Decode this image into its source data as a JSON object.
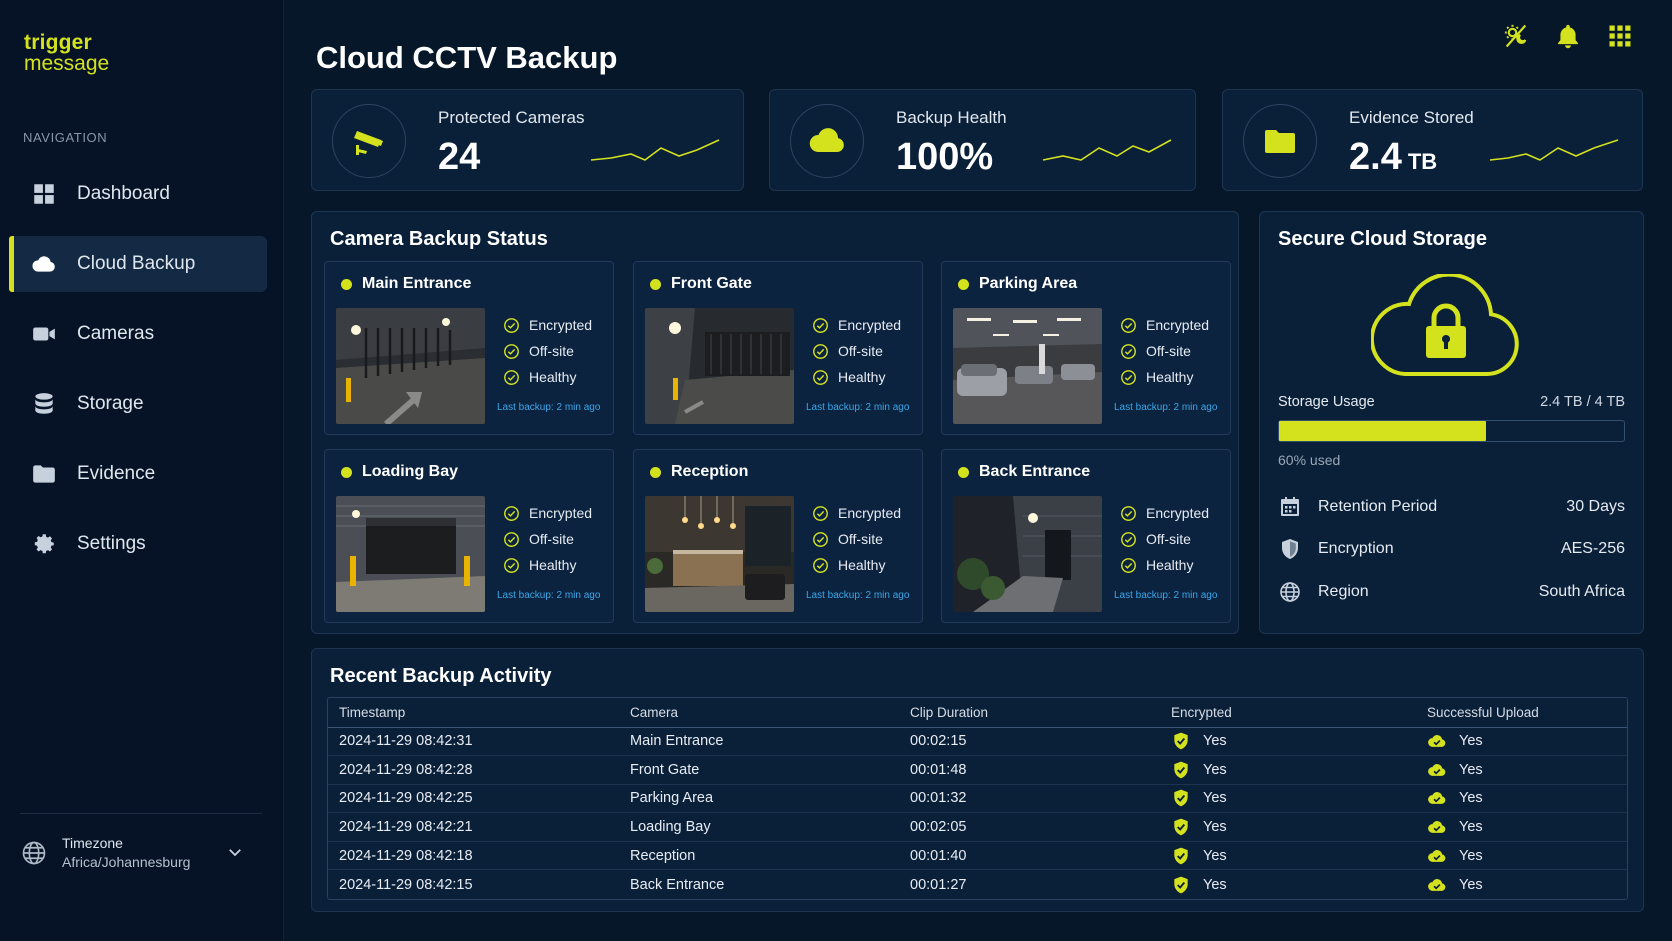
{
  "app": {
    "logo_line1": "trigger",
    "logo_line2": "message",
    "page_title": "Cloud CCTV Backup",
    "accent_color": "#d4e21e"
  },
  "sidebar": {
    "heading": "NAVIGATION",
    "items": [
      {
        "label": "Dashboard",
        "icon": "grid-icon",
        "active": false
      },
      {
        "label": "Cloud Backup",
        "icon": "cloud-icon",
        "active": true
      },
      {
        "label": "Cameras",
        "icon": "video-camera-icon",
        "active": false
      },
      {
        "label": "Storage",
        "icon": "database-icon",
        "active": false
      },
      {
        "label": "Evidence",
        "icon": "folder-icon",
        "active": false
      },
      {
        "label": "Settings",
        "icon": "gear-icon",
        "active": false
      }
    ],
    "timezone_label": "Timezone",
    "timezone_value": "Africa/Johannesburg"
  },
  "header_icons": [
    "sun-moon-icon",
    "bell-icon",
    "apps-grid-icon"
  ],
  "stats": [
    {
      "label": "Protected Cameras",
      "value": "24",
      "unit": "",
      "icon": "cctv-camera-icon"
    },
    {
      "label": "Backup Health",
      "value": "100%",
      "unit": "",
      "icon": "cloud-icon"
    },
    {
      "label": "Evidence Stored",
      "value": "2.4",
      "unit": "TB",
      "icon": "folder-icon"
    }
  ],
  "camera_status": {
    "title": "Camera Backup Status",
    "checks": [
      "Encrypted",
      "Off-site",
      "Healthy"
    ],
    "cameras": [
      {
        "name": "Main Entrance",
        "last_backup": "Last backup: 2 min ago"
      },
      {
        "name": "Front Gate",
        "last_backup": "Last backup: 2 min ago"
      },
      {
        "name": "Parking Area",
        "last_backup": "Last backup: 2 min ago"
      },
      {
        "name": "Loading Bay",
        "last_backup": "Last backup: 2 min ago"
      },
      {
        "name": "Reception",
        "last_backup": "Last backup: 2 min ago"
      },
      {
        "name": "Back Entrance",
        "last_backup": "Last backup: 2 min ago"
      }
    ]
  },
  "storage": {
    "title": "Secure Cloud Storage",
    "usage_label": "Storage Usage",
    "usage_value": "2.4 TB / 4 TB",
    "usage_fraction": 0.6,
    "used_text": "60% used",
    "rows": [
      {
        "label": "Retention Period",
        "value": "30 Days",
        "icon": "calendar-icon"
      },
      {
        "label": "Encryption",
        "value": "AES-256",
        "icon": "shield-icon"
      },
      {
        "label": "Region",
        "value": "South Africa",
        "icon": "globe-icon"
      }
    ]
  },
  "activity": {
    "title": "Recent Backup Activity",
    "columns": [
      "Timestamp",
      "Camera",
      "Clip Duration",
      "Encrypted",
      "Successful Upload"
    ],
    "rows": [
      {
        "timestamp": "2024-11-29 08:42:31",
        "camera": "Main Entrance",
        "duration": "00:02:15",
        "encrypted": "Yes",
        "upload": "Yes"
      },
      {
        "timestamp": "2024-11-29 08:42:28",
        "camera": "Front Gate",
        "duration": "00:01:48",
        "encrypted": "Yes",
        "upload": "Yes"
      },
      {
        "timestamp": "2024-11-29 08:42:25",
        "camera": "Parking Area",
        "duration": "00:01:32",
        "encrypted": "Yes",
        "upload": "Yes"
      },
      {
        "timestamp": "2024-11-29 08:42:21",
        "camera": "Loading Bay",
        "duration": "00:02:05",
        "encrypted": "Yes",
        "upload": "Yes"
      },
      {
        "timestamp": "2024-11-29 08:42:18",
        "camera": "Reception",
        "duration": "00:01:40",
        "encrypted": "Yes",
        "upload": "Yes"
      },
      {
        "timestamp": "2024-11-29 08:42:15",
        "camera": "Back Entrance",
        "duration": "00:01:27",
        "encrypted": "Yes",
        "upload": "Yes"
      }
    ]
  }
}
